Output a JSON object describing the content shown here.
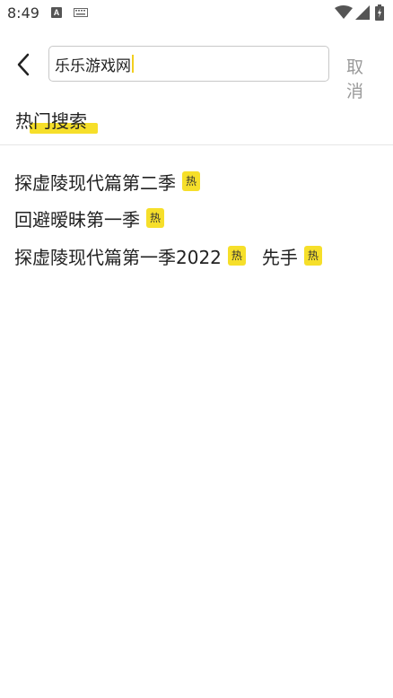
{
  "status_bar": {
    "time": "8:49",
    "icons": [
      "a-app-icon",
      "keyboard-icon",
      "wifi-icon",
      "signal-icon",
      "battery-icon"
    ]
  },
  "header": {
    "back_icon": "back-arrow-icon",
    "search": {
      "value": "乐乐游戏网"
    },
    "cancel_label": "取 消"
  },
  "hot_search": {
    "title": "热门搜索",
    "badge_label": "热",
    "items": [
      {
        "label": "探虚陵现代篇第二季",
        "hot": true
      },
      {
        "label": "回避暧昧第一季",
        "hot": true
      },
      {
        "label": "探虚陵现代篇第一季2022",
        "hot": true
      },
      {
        "label": "先手",
        "hot": true
      }
    ]
  },
  "colors": {
    "accent_yellow": "#f6df2a",
    "cancel_gray": "#9a9a9a",
    "text_dark": "#222222"
  }
}
